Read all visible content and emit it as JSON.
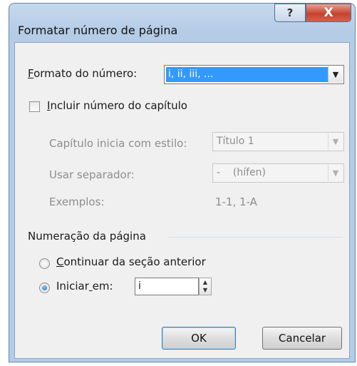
{
  "window": {
    "title": "Formatar número de página",
    "help_label": "?",
    "close_label": "X"
  },
  "format": {
    "label_first": "F",
    "label_rest": "ormato do número:",
    "value": "i, ii, iii, ..."
  },
  "chapter": {
    "checkbox_first": "I",
    "checkbox_rest": "ncluir número do capítulo",
    "checked": false,
    "style_label": "Capítulo inicia com estilo:",
    "style_value": "Título 1",
    "separator_label": "Usar separador:",
    "separator_value": "-    (hífen)",
    "examples_label": "Exemplos:",
    "examples_value": "1-1, 1-A"
  },
  "numbering": {
    "group_label": "Numeração da página",
    "continue_first": "C",
    "continue_rest": "ontinuar da seção anterior",
    "start_pre": "Iniciar",
    "start_ul": " ",
    "start_post": "em:",
    "start_value": "i",
    "selected_option": "start"
  },
  "buttons": {
    "ok": "OK",
    "cancel": "Cancelar"
  },
  "colors": {
    "selection": "#3399ff",
    "title_bar": "#b5cce6",
    "close_button": "#c6432e",
    "dialog_bg": "#f0f0f0"
  }
}
